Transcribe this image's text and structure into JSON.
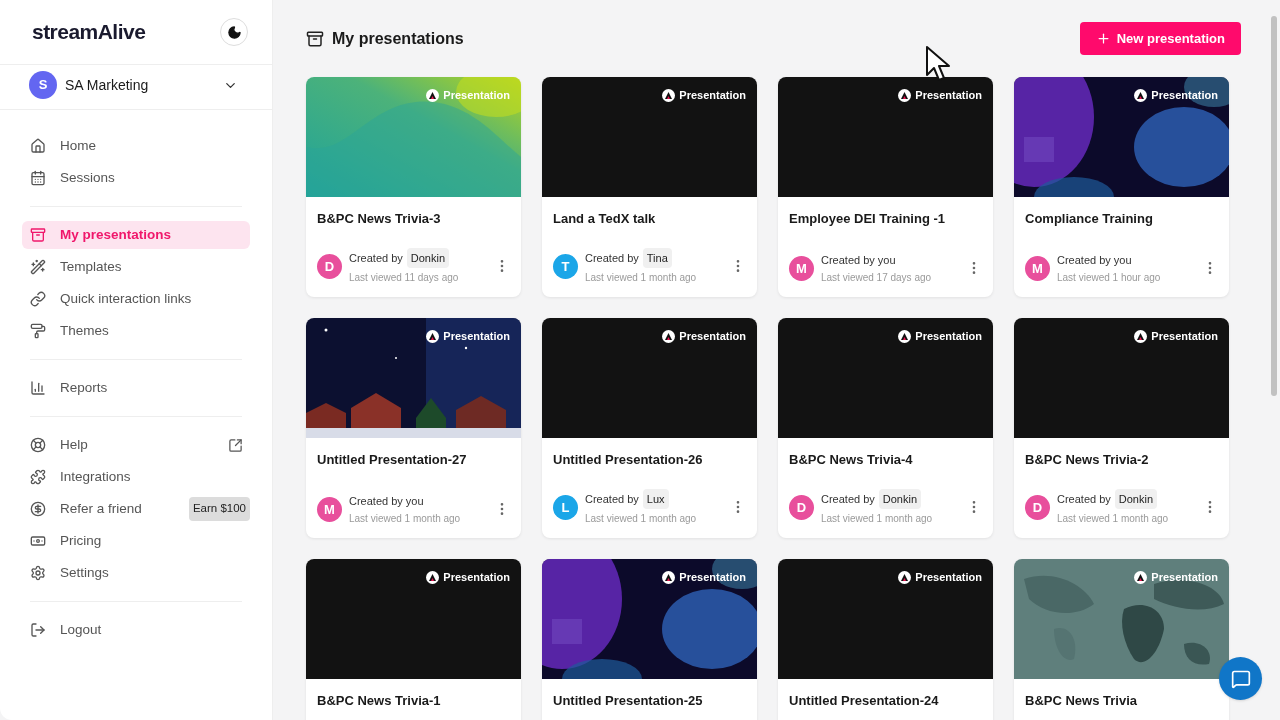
{
  "sidebar": {
    "brand": "streamAlive",
    "workspace": {
      "initial": "S",
      "name": "SA Marketing"
    },
    "groups": [
      [
        {
          "label": "Home",
          "selected": false
        },
        {
          "label": "Sessions",
          "selected": false
        }
      ],
      [
        {
          "label": "My presentations",
          "selected": true
        },
        {
          "label": "Templates",
          "selected": false
        },
        {
          "label": "Quick interaction links",
          "selected": false
        },
        {
          "label": "Themes",
          "selected": false
        }
      ],
      [
        {
          "label": "Reports",
          "selected": false
        }
      ],
      [
        {
          "label": "Help",
          "selected": false,
          "external": true
        },
        {
          "label": "Integrations",
          "selected": false
        },
        {
          "label": "Refer a friend",
          "selected": false,
          "badge": "Earn $100"
        },
        {
          "label": "Pricing",
          "selected": false
        },
        {
          "label": "Settings",
          "selected": false
        }
      ],
      [
        {
          "label": "Logout",
          "selected": false
        }
      ]
    ]
  },
  "page": {
    "title": "My presentations",
    "new_button": "New presentation"
  },
  "cards": [
    {
      "kind": "green",
      "tag": "Presentation",
      "title": "B&PC News Trivia-3",
      "avatar": "D",
      "color": "#e84f9c",
      "created_by": "Created by",
      "creator": "Donkin",
      "viewed": "Last viewed 11 days ago"
    },
    {
      "kind": "black",
      "tag": "Presentation",
      "title": "Land a TedX talk",
      "avatar": "T",
      "color": "#1ba6e8",
      "created_by": "Created by",
      "creator": "Tina",
      "viewed": "Last viewed 1 month ago"
    },
    {
      "kind": "black",
      "tag": "Presentation",
      "title": "Employee DEI Training -1",
      "avatar": "M",
      "color": "#e84f9c",
      "created_by": "Created by you",
      "viewed": "Last viewed 17 days ago"
    },
    {
      "kind": "purple",
      "tag": "Presentation",
      "title": "Compliance Training",
      "avatar": "M",
      "color": "#e84f9c",
      "created_by": "Created by you",
      "viewed": "Last viewed 1 hour ago"
    },
    {
      "kind": "night",
      "tag": "Presentation",
      "title": "Untitled Presentation-27",
      "avatar": "M",
      "color": "#e84f9c",
      "created_by": "Created by you",
      "viewed": "Last viewed 1 month ago"
    },
    {
      "kind": "black",
      "tag": "Presentation",
      "title": "Untitled Presentation-26",
      "avatar": "L",
      "color": "#1ba6e8",
      "created_by": "Created by",
      "creator": "Lux",
      "viewed": "Last viewed 1 month ago"
    },
    {
      "kind": "black",
      "tag": "Presentation",
      "title": "B&PC News Trivia-4",
      "avatar": "D",
      "color": "#e84f9c",
      "created_by": "Created by",
      "creator": "Donkin",
      "viewed": "Last viewed 1 month ago"
    },
    {
      "kind": "black",
      "tag": "Presentation",
      "title": "B&PC News Trivia-2",
      "avatar": "D",
      "color": "#e84f9c",
      "created_by": "Created by",
      "creator": "Donkin",
      "viewed": "Last viewed 1 month ago"
    },
    {
      "kind": "black",
      "tag": "Presentation",
      "title": "B&PC News Trivia-1"
    },
    {
      "kind": "purple",
      "tag": "Presentation",
      "title": "Untitled Presentation-25"
    },
    {
      "kind": "black",
      "tag": "Presentation",
      "title": "Untitled Presentation-24"
    },
    {
      "kind": "map",
      "tag": "Presentation",
      "title": "B&PC News Trivia"
    }
  ]
}
